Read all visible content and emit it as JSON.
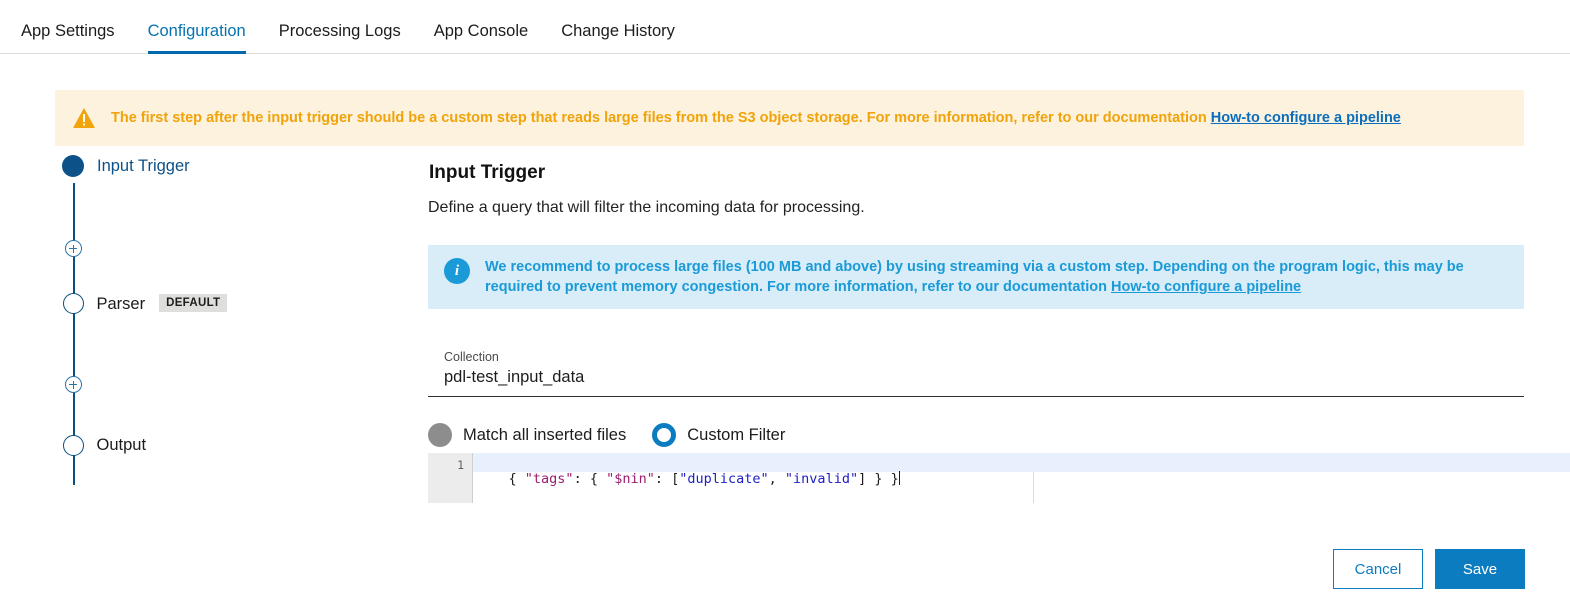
{
  "tabs": [
    {
      "label": "App Settings",
      "active": false
    },
    {
      "label": "Configuration",
      "active": true
    },
    {
      "label": "Processing Logs",
      "active": false
    },
    {
      "label": "App Console",
      "active": false
    },
    {
      "label": "Change History",
      "active": false
    }
  ],
  "warning_banner": {
    "icon": "warning-triangle-icon",
    "text": "The first step after the input trigger should be a custom step that reads large files from the S3 object storage. For more information, refer to our documentation ",
    "link_text": "How-to configure a pipeline",
    "bg_color": "#fdf2de",
    "text_color": "#f0a30a",
    "link_color": "#0a6ebd"
  },
  "stepper": {
    "nodes": [
      {
        "type": "filled",
        "label": "Input Trigger",
        "badge": ""
      },
      {
        "type": "add",
        "label": "",
        "badge": ""
      },
      {
        "type": "hollow",
        "label": "Parser",
        "badge": "DEFAULT"
      },
      {
        "type": "add",
        "label": "",
        "badge": ""
      },
      {
        "type": "hollow",
        "label": "Output",
        "badge": ""
      }
    ]
  },
  "panel": {
    "title": "Input Trigger",
    "subtitle": "Define a query that will filter the incoming data for processing.",
    "info_banner": {
      "icon": "info-circle-icon",
      "text": "We recommend to process large files (100 MB and above) by using streaming via a custom step. Depending on the program logic, this may be required to prevent memory congestion. For more information, refer to our documentation ",
      "link_text": "How-to configure a pipeline",
      "bg_color": "#d9edf9",
      "text_color": "#1a9ad7"
    },
    "collection_field": {
      "label": "Collection",
      "value": "pdl-test_input_data",
      "placeholder": "Collection"
    },
    "filter_mode": {
      "options": [
        {
          "label": "Match all inserted files",
          "selected": false
        },
        {
          "label": "Custom Filter",
          "selected": true
        }
      ]
    },
    "editor": {
      "line_number": "1",
      "tokens": [
        {
          "text": "{ ",
          "type": "punct"
        },
        {
          "text": "\"tags\"",
          "type": "key"
        },
        {
          "text": ": { ",
          "type": "punct"
        },
        {
          "text": "\"$nin\"",
          "type": "key"
        },
        {
          "text": ": [",
          "type": "punct"
        },
        {
          "text": "\"duplicate\"",
          "type": "str"
        },
        {
          "text": ", ",
          "type": "punct"
        },
        {
          "text": "\"invalid\"",
          "type": "str"
        },
        {
          "text": "] } }",
          "type": "punct"
        }
      ],
      "full_text": "{ \"tags\": { \"$nin\": [\"duplicate\", \"invalid\"] } }"
    }
  },
  "footer": {
    "cancel_label": "Cancel",
    "save_label": "Save",
    "primary_color": "#0c7cc0"
  }
}
